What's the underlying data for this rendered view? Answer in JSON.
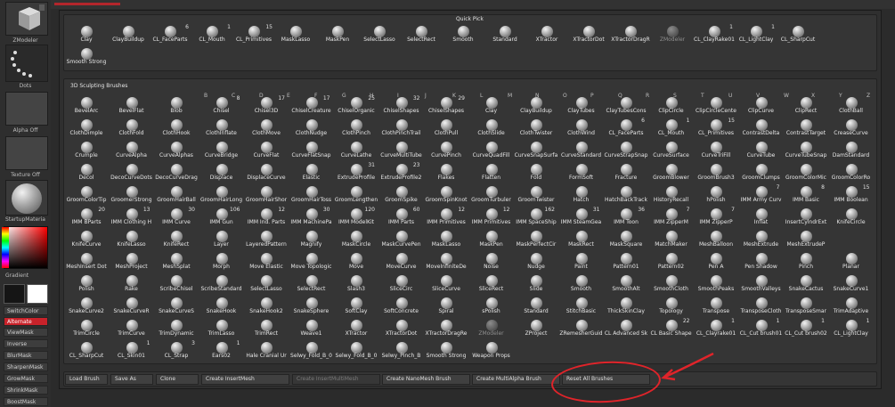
{
  "left_column": {
    "tool_label": "ZModeler",
    "stroke_label": "Dots",
    "alpha_label": "Alpha Off",
    "texture_label": "Texture Off",
    "material_label": "StartupMateria",
    "gradient_label": "Gradient",
    "buttons": [
      "SwitchColor",
      "Alternate",
      "ViewMask",
      "Inverse",
      "BlurMask",
      "SharpenMask",
      "GrowMask",
      "ShrinkMask",
      "BoostMask"
    ],
    "alternate_color": "#c8222a"
  },
  "quick_pick": {
    "title": "Quick Pick",
    "items": [
      {
        "label": "Clay"
      },
      {
        "label": "ClayBuildup"
      },
      {
        "label": "CL_FaceParts",
        "count": "6"
      },
      {
        "label": "CL_Mouth",
        "count": "1"
      },
      {
        "label": "CL_Primitives",
        "count": "15"
      },
      {
        "label": "MaskLasso"
      },
      {
        "label": "MaskPen"
      },
      {
        "label": "SelectLasso"
      },
      {
        "label": "SelectRect"
      },
      {
        "label": "Smooth"
      },
      {
        "label": "Standard"
      },
      {
        "label": "XTractor"
      },
      {
        "label": "XTractorDot"
      },
      {
        "label": "XTractorDragR"
      },
      {
        "label": "ZModeler"
      },
      {
        "label": "CL_ClayRake01",
        "count": "1"
      },
      {
        "label": "CL_LightClay",
        "count": "1"
      },
      {
        "label": "CL_SharpCut"
      },
      {
        "label": "Smooth Strong"
      }
    ]
  },
  "brushes": {
    "title": "3D Sculpting Brushes",
    "letters": [
      "B",
      "C",
      "D",
      "E",
      "F",
      "G",
      "H",
      "I",
      "J",
      "K",
      "L",
      "M",
      "N",
      "O",
      "P",
      "Q",
      "R",
      "S",
      "T",
      "U",
      "V",
      "W",
      "X",
      "Y",
      "Z"
    ],
    "rows": [
      [
        {
          "label": "BevelArc"
        },
        {
          "label": "BevelFlat"
        },
        {
          "label": "Blob"
        },
        {
          "label": "Chisel",
          "count": "8"
        },
        {
          "label": "Chisel3D",
          "count": "17"
        },
        {
          "label": "ChiselCreature",
          "count": "17"
        },
        {
          "label": "ChiselOrganic",
          "count": "25"
        },
        {
          "label": "ChiselShapes",
          "count": "32"
        },
        {
          "label": "ChiselShapes",
          "count": "29"
        },
        {
          "label": "Clay"
        },
        {
          "label": "ClayBuildup"
        },
        {
          "label": "ClayTubes"
        },
        {
          "label": "ClayTubesCons"
        },
        {
          "label": "ClipCircle"
        },
        {
          "label": "ClipCircleCente"
        },
        {
          "label": "ClipCurve"
        },
        {
          "label": "ClipRect"
        },
        {
          "label": "ClothBall"
        }
      ],
      [
        {
          "label": "ClothDimple"
        },
        {
          "label": "ClothFold"
        },
        {
          "label": "ClothHook"
        },
        {
          "label": "ClothInflate"
        },
        {
          "label": "ClothMove"
        },
        {
          "label": "ClothNudge"
        },
        {
          "label": "ClothPinch"
        },
        {
          "label": "ClothPinchTrail"
        },
        {
          "label": "ClothPull"
        },
        {
          "label": "ClothSlide"
        },
        {
          "label": "ClothTwister"
        },
        {
          "label": "ClothWind"
        },
        {
          "label": "CL_FaceParts",
          "count": "6"
        },
        {
          "label": "CL_Mouth",
          "count": "1"
        },
        {
          "label": "CL_Primitives",
          "count": "15"
        },
        {
          "label": "ContrastDelta"
        },
        {
          "label": "ContrastTarget"
        },
        {
          "label": "CreaseCurve"
        }
      ],
      [
        {
          "label": "Crumple"
        },
        {
          "label": "CurveAlpha"
        },
        {
          "label": "CurveAlphas"
        },
        {
          "label": "CurveBridge"
        },
        {
          "label": "CurveFlat"
        },
        {
          "label": "CurveFlatSnap"
        },
        {
          "label": "CurveLathe"
        },
        {
          "label": "CurveMultiTube"
        },
        {
          "label": "CurvePinch"
        },
        {
          "label": "CurveQuadFill"
        },
        {
          "label": "CurveSnapSurfa"
        },
        {
          "label": "CurveStandard"
        },
        {
          "label": "CurveStrapSnap"
        },
        {
          "label": "CurveSurface"
        },
        {
          "label": "CurveTriFill"
        },
        {
          "label": "CurveTube"
        },
        {
          "label": "CurveTubeSnap"
        },
        {
          "label": "DamStandard"
        }
      ],
      [
        {
          "label": "Decol"
        },
        {
          "label": "DecoCurveDots"
        },
        {
          "label": "DecoCurveDrag"
        },
        {
          "label": "Displace"
        },
        {
          "label": "DisplaceCurve"
        },
        {
          "label": "Elastic"
        },
        {
          "label": "ExtrudeProfile",
          "count": "31"
        },
        {
          "label": "ExtrudeProfile2",
          "count": "23"
        },
        {
          "label": "Flakes"
        },
        {
          "label": "Flatten"
        },
        {
          "label": "Fold"
        },
        {
          "label": "FormSoft"
        },
        {
          "label": "Fracture"
        },
        {
          "label": "GroomBlower"
        },
        {
          "label": "GroomBrush3"
        },
        {
          "label": "GroomClumps"
        },
        {
          "label": "GroomColorMic"
        },
        {
          "label": "GroomColorRo"
        }
      ],
      [
        {
          "label": "GroomColorTip"
        },
        {
          "label": "GroomerStrong"
        },
        {
          "label": "GroomHairBall"
        },
        {
          "label": "GroomHairLong"
        },
        {
          "label": "GroomHairShor"
        },
        {
          "label": "GroomHairToss"
        },
        {
          "label": "GroomLengthen"
        },
        {
          "label": "GroomSpike"
        },
        {
          "label": "GroomSpinKnot"
        },
        {
          "label": "GroomTurbuler"
        },
        {
          "label": "GroomTwister"
        },
        {
          "label": "Hatch"
        },
        {
          "label": "HatchBackTrack"
        },
        {
          "label": "HistoryRecall"
        },
        {
          "label": "hPolish"
        },
        {
          "label": "IMM Army Curv",
          "count": "7"
        },
        {
          "label": "IMM Basic",
          "count": "8"
        },
        {
          "label": "IMM Boolean",
          "count": "15"
        }
      ],
      [
        {
          "label": "IMM BParts",
          "count": "20"
        },
        {
          "label": "IMM Clothing H",
          "count": "13"
        },
        {
          "label": "IMM Curve",
          "count": "30"
        },
        {
          "label": "IMM Gun",
          "count": "106"
        },
        {
          "label": "IMM Ind. Parts",
          "count": "12"
        },
        {
          "label": "IMM MachinePa",
          "count": "30"
        },
        {
          "label": "IMM ModelKit",
          "count": "120"
        },
        {
          "label": "IMM Parts",
          "count": "60"
        },
        {
          "label": "IMM Primitives",
          "count": "12"
        },
        {
          "label": "IMM Primitives",
          "count": "12"
        },
        {
          "label": "IMM SpaceShip",
          "count": "162"
        },
        {
          "label": "IMM SteamGea",
          "count": "31"
        },
        {
          "label": "IMM Toon",
          "count": "36"
        },
        {
          "label": "IMM ZipperM",
          "count": "7"
        },
        {
          "label": "IMM ZipperP",
          "count": "7"
        },
        {
          "label": "Inflat"
        },
        {
          "label": "InsertCylndrExt"
        },
        {
          "label": "KnifeCircle"
        }
      ],
      [
        {
          "label": "KnifeCurve"
        },
        {
          "label": "KnifeLasso"
        },
        {
          "label": "KnifeRect"
        },
        {
          "label": "Layer"
        },
        {
          "label": "LayeredPattern"
        },
        {
          "label": "Magnify"
        },
        {
          "label": "MaskCircle"
        },
        {
          "label": "MaskCurvePen"
        },
        {
          "label": "MaskLasso"
        },
        {
          "label": "MaskPen"
        },
        {
          "label": "MaskPerfectCir"
        },
        {
          "label": "MaskRect"
        },
        {
          "label": "MaskSquare"
        },
        {
          "label": "MatchMaker"
        },
        {
          "label": "MeshBalloon"
        },
        {
          "label": "MeshExtrude"
        },
        {
          "label": "MeshExtrudeP"
        }
      ],
      [
        {
          "label": "MeshInsert Dot"
        },
        {
          "label": "MeshProject"
        },
        {
          "label": "MeshSplat"
        },
        {
          "label": "Morph"
        },
        {
          "label": "Move Elastic"
        },
        {
          "label": "Move Topologic"
        },
        {
          "label": "Move"
        },
        {
          "label": "MoveCurve"
        },
        {
          "label": "MoveInfiniteDe"
        },
        {
          "label": "Noise"
        },
        {
          "label": "Nudge"
        },
        {
          "label": "Paint"
        },
        {
          "label": "Pattern01"
        },
        {
          "label": "Pattern02"
        },
        {
          "label": "Pen A"
        },
        {
          "label": "Pen Shadow"
        },
        {
          "label": "Pinch"
        },
        {
          "label": "Planar"
        }
      ],
      [
        {
          "label": "Polish"
        },
        {
          "label": "Rake"
        },
        {
          "label": "ScribeChisel"
        },
        {
          "label": "ScribeStandard"
        },
        {
          "label": "SelectLasso"
        },
        {
          "label": "SelectRect"
        },
        {
          "label": "Slash3"
        },
        {
          "label": "SliceCirc"
        },
        {
          "label": "SliceCurve"
        },
        {
          "label": "SliceRect"
        },
        {
          "label": "Slide"
        },
        {
          "label": "Smooth"
        },
        {
          "label": "SmoothAlt"
        },
        {
          "label": "SmoothCloth"
        },
        {
          "label": "SmoothPeaks"
        },
        {
          "label": "SmoothValleys"
        },
        {
          "label": "SnakeCactus"
        },
        {
          "label": "SnakeCurve1"
        }
      ],
      [
        {
          "label": "SnakeCurve2"
        },
        {
          "label": "SnakeCurveR"
        },
        {
          "label": "SnakeCurveS"
        },
        {
          "label": "SnakeHook"
        },
        {
          "label": "SnakeHook2"
        },
        {
          "label": "SnakeSphere"
        },
        {
          "label": "SoftClay"
        },
        {
          "label": "SoftConcrete"
        },
        {
          "label": "Spiral"
        },
        {
          "label": "sPolish"
        },
        {
          "label": "Standard"
        },
        {
          "label": "StitchBasic"
        },
        {
          "label": "ThickSkinClay"
        },
        {
          "label": "Topology"
        },
        {
          "label": "Transpose"
        },
        {
          "label": "TransposeCloth"
        },
        {
          "label": "TransposeSmar"
        },
        {
          "label": "TrimAdaptive"
        }
      ],
      [
        {
          "label": "TrimCircle"
        },
        {
          "label": "TrimCurve"
        },
        {
          "label": "TrimDynamic"
        },
        {
          "label": "TrimLasso"
        },
        {
          "label": "TrimRect"
        },
        {
          "label": "Weave1"
        },
        {
          "label": "XTractor"
        },
        {
          "label": "XTractorDot"
        },
        {
          "label": "XTractorDragRe"
        },
        {
          "label": "ZModeler"
        },
        {
          "label": "ZProject"
        },
        {
          "label": "ZRemesherGuid"
        },
        {
          "label": "CL Advanced Sk"
        },
        {
          "label": "CL Basic Shape",
          "count": "22"
        },
        {
          "label": "CL_Clayrake01",
          "count": "1"
        },
        {
          "label": "CL_Cut brush01",
          "count": "1"
        },
        {
          "label": "CL_Cut brush02",
          "count": "1"
        },
        {
          "label": "CL_LightClay",
          "count": "1"
        }
      ],
      [
        {
          "label": "CL_SharpCut"
        },
        {
          "label": "CL_Skin01",
          "count": "1"
        },
        {
          "label": "CL_Strap",
          "count": "3"
        },
        {
          "label": "Ears02",
          "count": "1"
        },
        {
          "label": "Hale Cranial Ur"
        },
        {
          "label": "Selwy_Fold_B_0"
        },
        {
          "label": "Selwy_Fold_B_0"
        },
        {
          "label": "Selwy_Pinch_B"
        },
        {
          "label": "Smooth Strong"
        },
        {
          "label": "Weapon Props"
        }
      ]
    ]
  },
  "bottom_buttons": {
    "load": "Load Brush",
    "save_as": "Save As",
    "clone": "Clone",
    "create_insert": "Create InsertMesh",
    "create_insert_multi": "Create InsertMultiMesh",
    "create_nanomesh": "Create NanoMesh Brush",
    "create_multialpha": "Create MultiAlpha Brush",
    "reset_all": "Reset All Brushes"
  },
  "annotation_color": "#e0242a"
}
